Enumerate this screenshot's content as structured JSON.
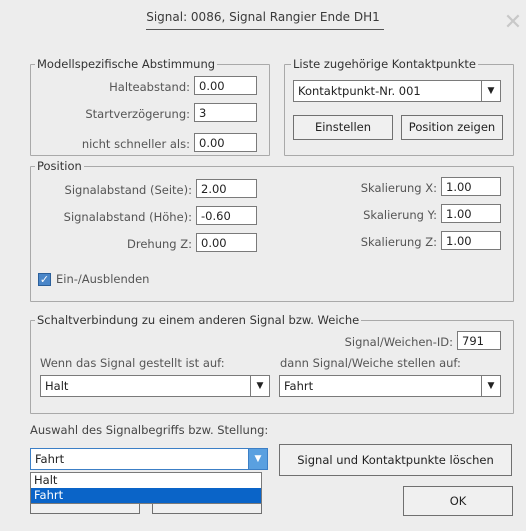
{
  "window": {
    "title": "Signal: 0086, Signal Rangier Ende DH1",
    "close_glyph": "✕"
  },
  "modell": {
    "legend": "Modellspezifische Abstimmung",
    "halteabstand_label": "Halteabstand:",
    "halteabstand_value": "0.00",
    "startverzoegerung_label": "Startverzögerung:",
    "startverzoegerung_value": "3",
    "nicht_schneller_label": "nicht schneller als:",
    "nicht_schneller_value": "0.00"
  },
  "kontakt": {
    "legend": "Liste zugehörige Kontaktpunkte",
    "selected": "Kontaktpunkt-Nr. 001",
    "einstellen_label": "Einstellen",
    "position_zeigen_label": "Position zeigen"
  },
  "position": {
    "legend": "Position",
    "seite_label": "Signalabstand (Seite):",
    "seite_value": "2.00",
    "hoehe_label": "Signalabstand (Höhe):",
    "hoehe_value": "-0.60",
    "drehung_label": "Drehung Z:",
    "drehung_value": "0.00",
    "skal_x_label": "Skalierung X:",
    "skal_x_value": "1.00",
    "skal_y_label": "Skalierung Y:",
    "skal_y_value": "1.00",
    "skal_z_label": "Skalierung Z:",
    "skal_z_value": "1.00",
    "einausblenden_label": "Ein-/Ausblenden",
    "einausblenden_checked": true
  },
  "schalt": {
    "legend": "Schaltverbindung zu einem anderen Signal bzw. Weiche",
    "id_label": "Signal/Weichen-ID:",
    "id_value": "791",
    "wenn_label": "Wenn das Signal gestellt ist auf:",
    "wenn_value": "Halt",
    "dann_label": "dann Signal/Weiche stellen auf:",
    "dann_value": "Fahrt"
  },
  "auswahl": {
    "label": "Auswahl des Signalbegriffs bzw. Stellung:",
    "selected": "Fahrt",
    "options": [
      "Halt",
      "Fahrt"
    ]
  },
  "buttons": {
    "loeschen_label": "Signal und Kontaktpunkte löschen",
    "ok_label": "OK"
  },
  "colors": {
    "dialog_bg": "#ededed",
    "accent": "#0a64c8",
    "checkbox": "#4a86c8"
  }
}
